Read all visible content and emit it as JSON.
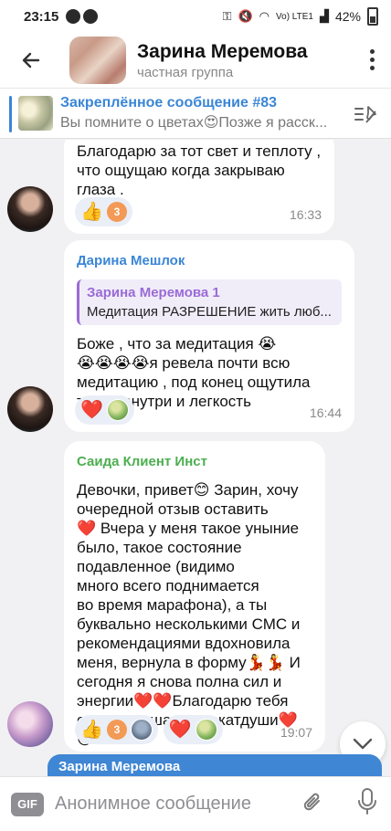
{
  "status": {
    "time": "23:15",
    "battery": "42%",
    "network": "Vo) LTE1"
  },
  "header": {
    "title": "Зарина Меремова",
    "subtitle": "частная группа"
  },
  "pinned": {
    "title": "Закреплённое сообщение #83",
    "preview": "Вы помните о цветах😍Позже я расск..."
  },
  "messages": [
    {
      "text_lines": [
        "Благодарю за тот свет и теплоту ,",
        "что ощущаю когда закрываю",
        "глаза ."
      ],
      "reactions": [
        {
          "emoji": "👍",
          "count": "3"
        }
      ],
      "time": "16:33"
    },
    {
      "sender": "Дарина Мешлок",
      "reply": {
        "name": "Зарина Меремова 1",
        "text": "Медитация РАЗРЕШЕНИЕ жить люб..."
      },
      "text_lines": [
        "Боже , что за медитация 😭",
        "😭😭😭😭я ревела почти всю",
        "медитацию , под конец ощутила",
        "тепло внутри и легкость"
      ],
      "reactions": [
        {
          "emoji": "❤️"
        }
      ],
      "time": "16:44"
    },
    {
      "sender": "Саида Клиент Инст",
      "text_lines": [
        "Девочки, привет😊 Зарин, хочу",
        "очередной отзыв оставить",
        "❤️ Вчера у меня такое уныние",
        "было, такое состояние",
        "подавленное (видимо",
        "много всего поднимается",
        "во время марафона), а ты",
        "буквально несколькими СМС и",
        "рекомендациями вдохновила",
        "меня, вернула в форму💃💃 И",
        "сегодня я снова полна сил и",
        "энергии❤️❤️Благодарю тебя",
        "самая лучшая адвокатдуши❤️😘"
      ],
      "reactions": [
        {
          "emoji": "👍",
          "count": "3"
        },
        {
          "emoji": "❤️"
        }
      ],
      "time": "19:07"
    }
  ],
  "reply_strip": "Зарина Меремова",
  "composer": {
    "gif_label": "GIF",
    "placeholder": "Анонимное сообщение"
  },
  "colors": {
    "accent": "#3a86d6",
    "sender2": "#3a86d6",
    "sender3": "#4caf50",
    "reply_accent": "#9a6bd6"
  }
}
